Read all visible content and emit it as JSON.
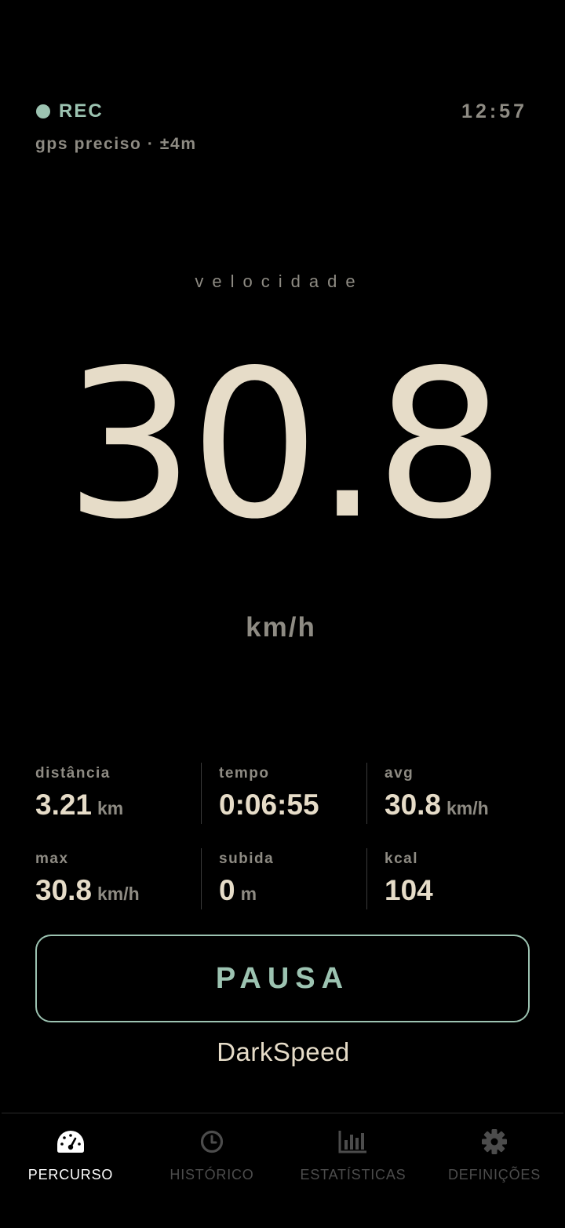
{
  "status": {
    "rec_label": "REC",
    "clock": "12:57",
    "gps": "gps preciso · ±4m",
    "rec_color": "#9cc3b1"
  },
  "speed": {
    "label": "velocidade",
    "value": "30.8",
    "unit": "km/h"
  },
  "stats": [
    {
      "label": "distância",
      "value": "3.21",
      "unit": "km"
    },
    {
      "label": "tempo",
      "value": "0:06:55",
      "unit": ""
    },
    {
      "label": "avg",
      "value": "30.8",
      "unit": "km/h"
    },
    {
      "label": "max",
      "value": "30.8",
      "unit": "km/h"
    },
    {
      "label": "subida",
      "value": "0",
      "unit": "m"
    },
    {
      "label": "kcal",
      "value": "104",
      "unit": ""
    }
  ],
  "pause_label": "PAUSA",
  "brand": "DarkSpeed",
  "nav": {
    "items": [
      {
        "label": "PERCURSO",
        "icon": "speedometer-icon",
        "active": true
      },
      {
        "label": "HISTÓRICO",
        "icon": "clock-icon",
        "active": false
      },
      {
        "label": "ESTATÍSTICAS",
        "icon": "bar-chart-icon",
        "active": false
      },
      {
        "label": "DEFINIÇÕES",
        "icon": "gear-icon",
        "active": false
      }
    ]
  },
  "colors": {
    "accent": "#9cc3b1",
    "primary_text": "#e6dcc8",
    "muted_text": "#8e8b83",
    "background": "#000000"
  }
}
